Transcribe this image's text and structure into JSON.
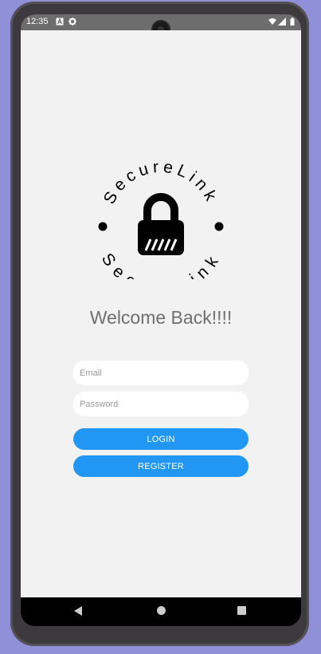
{
  "status_bar": {
    "time": "12:35",
    "left_icons": [
      "a-icon",
      "gear-icon"
    ],
    "right_icons": [
      "wifi-icon",
      "signal-icon",
      "battery-icon"
    ]
  },
  "logo": {
    "text_top": "SecureLink",
    "text_bottom": "SecureLink"
  },
  "welcome_text": "Welcome Back!!!!",
  "email": {
    "placeholder": "Email",
    "value": ""
  },
  "password": {
    "placeholder": "Password",
    "value": ""
  },
  "login_label": "LOGIN",
  "register_label": "REGISTER",
  "colors": {
    "primary_button": "#2196f3",
    "background": "#f2f2f2",
    "welcome_text": "#707070"
  },
  "nav_icons": [
    "back-icon",
    "home-icon",
    "recents-icon"
  ]
}
